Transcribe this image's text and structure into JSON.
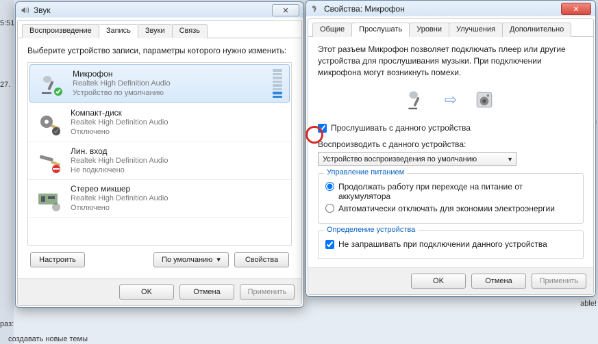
{
  "bg": {
    "left_time": "5:51",
    "label_27": "27.",
    "raz": "раз:",
    "bottom": "создавать новые темы",
    "right1": "o In",
    "right2": "able!"
  },
  "sound": {
    "title": "Звук",
    "close_glyph": "✕",
    "tabs": [
      "Воспроизведение",
      "Запись",
      "Звуки",
      "Связь"
    ],
    "active_tab": 1,
    "instruction": "Выберите устройство записи, параметры которого нужно изменить:",
    "devices": [
      {
        "name": "Микрофон",
        "driver": "Realtek High Definition Audio",
        "status": "Устройство по умолчанию"
      },
      {
        "name": "Компакт-диск",
        "driver": "Realtek High Definition Audio",
        "status": "Отключено"
      },
      {
        "name": "Лин. вход",
        "driver": "Realtek High Definition Audio",
        "status": "Не подключено"
      },
      {
        "name": "Стерео микшер",
        "driver": "Realtek High Definition Audio",
        "status": "Отключено"
      }
    ],
    "btn_configure": "Настроить",
    "btn_default": "По умолчанию",
    "btn_default_caret": "▾",
    "btn_props": "Свойства",
    "ok": "OK",
    "cancel": "Отмена",
    "apply": "Применить"
  },
  "props": {
    "title": "Свойства: Микрофон",
    "close_glyph": "✕",
    "tabs": [
      "Общие",
      "Прослушать",
      "Уровни",
      "Улучшения",
      "Дополнительно"
    ],
    "active_tab": 1,
    "paragraph": "Этот разъем Микрофон позволяет подключать плеер или другие устройства для прослушивания музыки. При подключении микрофона могут возникнуть помехи.",
    "arrow": "⇨",
    "listen_chk": "Прослушивать с данного устройства",
    "listen_checked": true,
    "play_through_label": "Воспроизводить с данного устройства:",
    "play_through_value": "Устройство воспроизведения по умолчанию",
    "group_power": "Управление питанием",
    "radio1": "Продолжать работу при переходе на питание от аккумулятора",
    "radio2": "Автоматически отключать для экономии электроэнергии",
    "radio_selected": 0,
    "group_detect": "Определение устройства",
    "detect_chk": "Не запрашивать при подключении данного устройства",
    "detect_checked": true,
    "ok": "OK",
    "cancel": "Отмена",
    "apply": "Применить"
  }
}
